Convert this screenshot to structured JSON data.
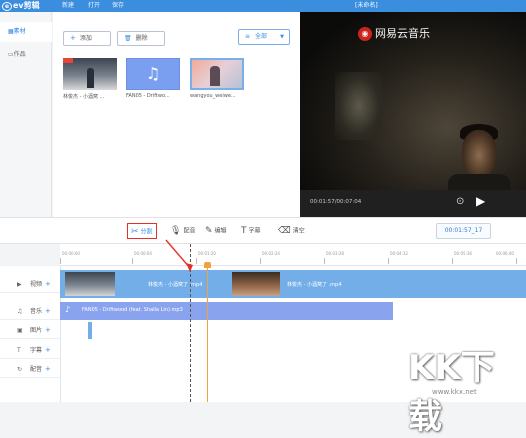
{
  "app": {
    "logo": "ev剪辑",
    "menu": [
      "新建",
      "打开",
      "保存"
    ],
    "window_title": "[未命名]"
  },
  "sidebar": {
    "items": [
      {
        "label": "素材",
        "icon": "grid-icon"
      },
      {
        "label": "作品",
        "icon": "works-icon"
      }
    ]
  },
  "library": {
    "add_label": "添加",
    "delete_label": "删除",
    "filter_label": "全部",
    "items": [
      {
        "label": "林俊杰 - 小酒窝 ...",
        "kind": "video"
      },
      {
        "label": "FAN05 - Driftwo...",
        "kind": "audio"
      },
      {
        "label": "wangyou_weiwe...",
        "kind": "video"
      }
    ]
  },
  "preview": {
    "watermark": "网易云音乐",
    "time": "00:01:57/00:07:04"
  },
  "toolbar": {
    "tools": [
      {
        "label": "分割",
        "icon": "scissors-icon"
      },
      {
        "label": "配音",
        "icon": "microphone-icon"
      },
      {
        "label": "编辑",
        "icon": "pencil-icon"
      },
      {
        "label": "字幕",
        "icon": "text-icon"
      },
      {
        "label": "清空",
        "icon": "eraser-icon"
      }
    ],
    "time_display": "00:01:57_17"
  },
  "ruler": {
    "ticks": [
      "00:00:00",
      "00:00:04",
      "00:01:20",
      "00:02:24",
      "00:03:28",
      "00:04:32",
      "00:05:36",
      "00:06:40"
    ]
  },
  "tracks": [
    {
      "label": "视频",
      "icon": "film-icon"
    },
    {
      "label": "音乐",
      "icon": "music-icon"
    },
    {
      "label": "图片",
      "icon": "image-icon"
    },
    {
      "label": "字幕",
      "icon": "text-icon"
    },
    {
      "label": "配音",
      "icon": "voice-icon"
    }
  ],
  "clips": {
    "video1": "林俊杰 - 小酒窝了 .mp4",
    "video2": "林俊杰 - 小酒窝了 .mp4",
    "audio1": "FAN05 - Driftwood (feat. Shalla Lin).mp3"
  },
  "watermark": {
    "text": "KK下载",
    "url": "www.kkx.net"
  },
  "colors": {
    "accent": "#3b8dde",
    "video_track": "#74aee8",
    "audio_track": "#8aa3ee",
    "playhead": "#f2a23a",
    "highlight": "#e5302a"
  }
}
